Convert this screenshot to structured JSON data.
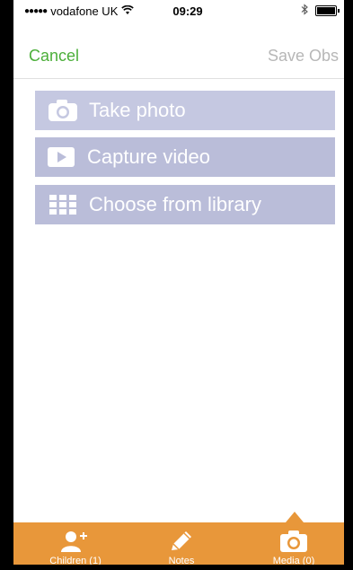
{
  "status_bar": {
    "carrier": "vodafone UK",
    "signal_dots": "●●●●●",
    "time": "09:29"
  },
  "nav": {
    "cancel_label": "Cancel",
    "save_label": "Save Obs"
  },
  "media_options": {
    "take_photo": "Take photo",
    "capture_video": "Capture video",
    "choose_library": "Choose from library"
  },
  "tabs": {
    "children": "Children (1)",
    "notes": "Notes",
    "media": "Media (0)"
  },
  "colors": {
    "accent_green": "#4caf3a",
    "tab_orange": "#e8973a",
    "button_purple": "#babdd9",
    "disabled_gray": "#b7b7b7"
  },
  "icons": {
    "camera": "camera-icon",
    "video": "video-play-icon",
    "library": "grid-icon",
    "children": "add-person-icon",
    "notes": "pencil-icon",
    "media": "camera-icon"
  }
}
